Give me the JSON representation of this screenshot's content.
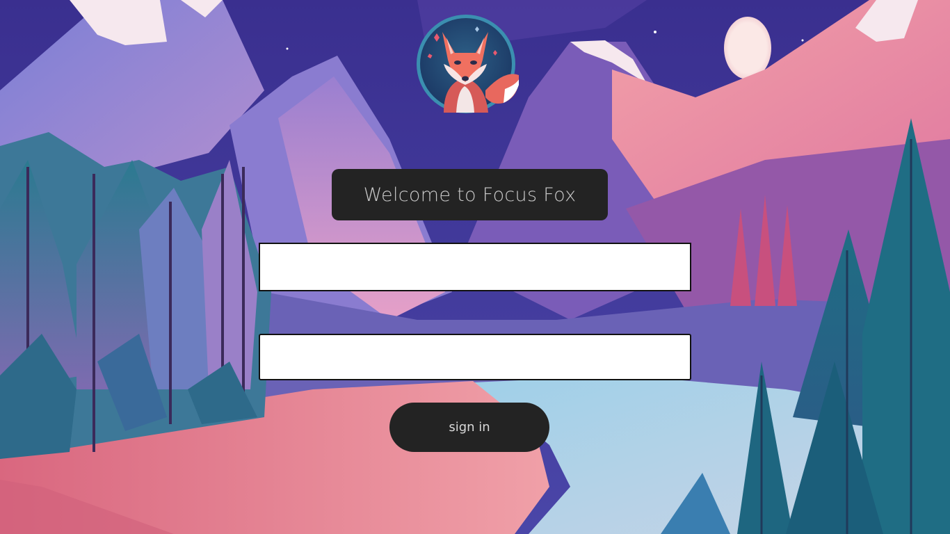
{
  "app": {
    "welcome_text": "Welcome to Focus Fox",
    "logo_icon": "fox-logo-icon"
  },
  "form": {
    "username_value": "",
    "password_value": "",
    "signin_label": "sign in"
  },
  "colors": {
    "panel_bg": "#232323",
    "panel_text": "#c9c9c9",
    "sky": "#3a3a9c",
    "moon": "#f9e6e6"
  }
}
